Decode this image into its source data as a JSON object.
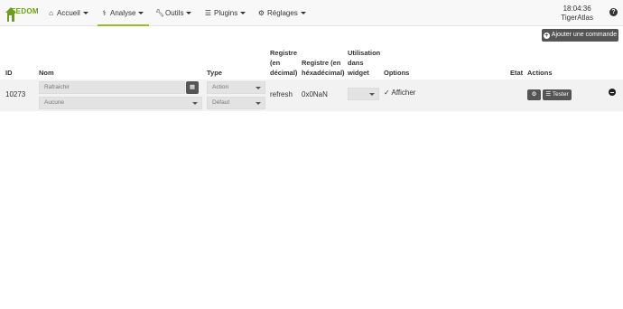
{
  "navbar": {
    "logo_text": "EEDOM",
    "items": [
      {
        "label": "Accueil",
        "icon": "home-icon"
      },
      {
        "label": "Analyse",
        "icon": "stethoscope-icon"
      },
      {
        "label": "Outils",
        "icon": "wrench-icon"
      },
      {
        "label": "Plugins",
        "icon": "list-icon"
      },
      {
        "label": "Réglages",
        "icon": "gear-icon"
      }
    ],
    "active_item": "Analyse",
    "time": "18:04:36",
    "user": "TigerAtlas",
    "help": "?"
  },
  "toolbar": {
    "add_command_label": "Ajouter une commande"
  },
  "table": {
    "headers": {
      "id": "ID",
      "name": "Nom",
      "type": "Type",
      "reg_dec_1": "Registre",
      "reg_dec_2": "(en",
      "reg_dec_3": "décimal)",
      "reg_hex_1": "Registre (en",
      "reg_hex_2": "héxadécimal)",
      "widget_1": "Utilisation",
      "widget_2": "dans",
      "widget_3": "widget",
      "options": "Options",
      "etat": "Etat",
      "actions": "Actions"
    },
    "rows": [
      {
        "id": "10273",
        "name_placeholder": "Rafraichir",
        "value_select": "Aucune",
        "type": "Action",
        "subtype": "Défaut",
        "reg_dec": "refresh",
        "reg_hex": "0x0NaN",
        "widget_select": "",
        "option_label": "Afficher",
        "test_label": "Tester"
      }
    ]
  },
  "colors": {
    "accent": "#94c12b",
    "dark_button": "#555555",
    "row_bg": "#f2f2f2"
  }
}
